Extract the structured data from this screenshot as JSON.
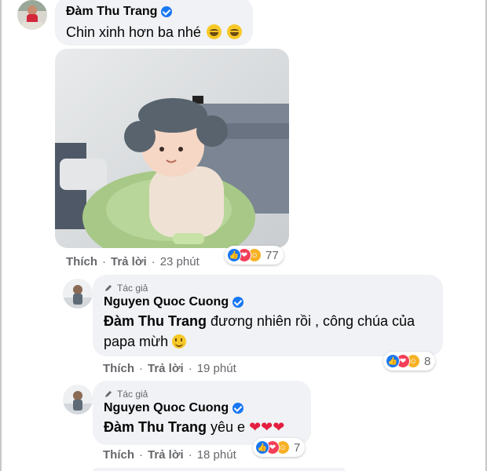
{
  "comment1": {
    "author": "Đàm Thu Trang",
    "text": "Chin xinh hơn ba nhé",
    "emoji": [
      "grinning-face-icon",
      "grinning-face-icon"
    ],
    "actions": {
      "like": "Thích",
      "reply": "Trả lời",
      "time": "23 phút"
    },
    "reaction_count": "77"
  },
  "reply1": {
    "badge": "Tác giả",
    "author": "Nguyen Quoc Cuong",
    "mention": "Đàm Thu Trang",
    "text": " đương nhiên rồi , công chúa của papa mừh",
    "actions": {
      "like": "Thích",
      "reply": "Trả lời",
      "time": "19 phút"
    },
    "reaction_count": "8"
  },
  "reply2": {
    "badge": "Tác giả",
    "author": "Nguyen Quoc Cuong",
    "mention": "Đàm Thu Trang",
    "text": " yêu e",
    "actions": {
      "like": "Thích",
      "reply": "Trả lời",
      "time": "18 phút"
    },
    "reaction_count": "7"
  },
  "colors": {
    "verified": "#1877f2",
    "bubble": "#f0f2f5",
    "meta": "#65676b",
    "heart": "#e41e3f"
  }
}
